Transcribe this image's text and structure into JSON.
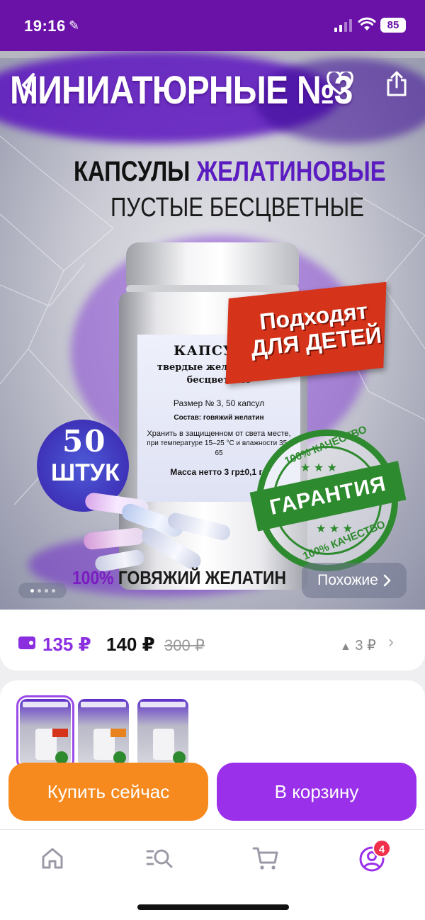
{
  "status_bar": {
    "time": "19:16",
    "battery": "85"
  },
  "hero": {
    "banner_title": "МИНИАТЮРНЫЕ №3",
    "title_word1": "КАПСУЛЫ",
    "title_word2": "ЖЕЛАТИНОВЫЕ",
    "subtitle": "ПУСТЫЕ БЕСЦВЕТНЫЕ",
    "label": {
      "line1": "КАПСУЛЫ",
      "line2": "твердые желатиновые",
      "line2b": "бесцветные",
      "size": "Размер № 3,   50 капсул",
      "composition": "Состав: говяжий желатин",
      "storage1": "Хранить в защищенном от света месте,",
      "storage2": "при температуре 15–25 °С и влажности 35–65",
      "mass": "Масса нетто 3 гр±0,1 гр"
    },
    "badge_line1": "Подходят",
    "badge_line2": "ДЛЯ ДЕТЕЙ",
    "stamp_top": "100% КАЧЕСТВО",
    "stamp_center": "ГАРАНТИЯ",
    "stamp_bottom": "100% КАЧЕСТВО",
    "count_number": "50",
    "count_unit": "ШТУК",
    "bottom_pct": "100%",
    "bottom_text": "ГОВЯЖИЙ ЖЕЛАТИН",
    "similar_label": "Похожие",
    "carousel_index": 1,
    "carousel_total": 4
  },
  "price": {
    "wallet_price": "135 ₽",
    "price": "140 ₽",
    "old_price": "300 ₽",
    "delta": "3 ₽"
  },
  "thumbnails": {
    "count": 3,
    "selected": 1
  },
  "actions": {
    "buy_now": "Купить сейчас",
    "add_to_cart": "В корзину"
  },
  "bottom_nav": {
    "items": [
      "home-icon",
      "catalog-search-icon",
      "cart-icon",
      "profile-icon"
    ],
    "profile_badge": "4"
  },
  "colors": {
    "brand_purple": "#6a12a8",
    "accent_purple": "#9b30ea",
    "accent_orange": "#f68a1f",
    "wallet_purple": "#8b2ee0",
    "badge_red": "#f0314c"
  }
}
